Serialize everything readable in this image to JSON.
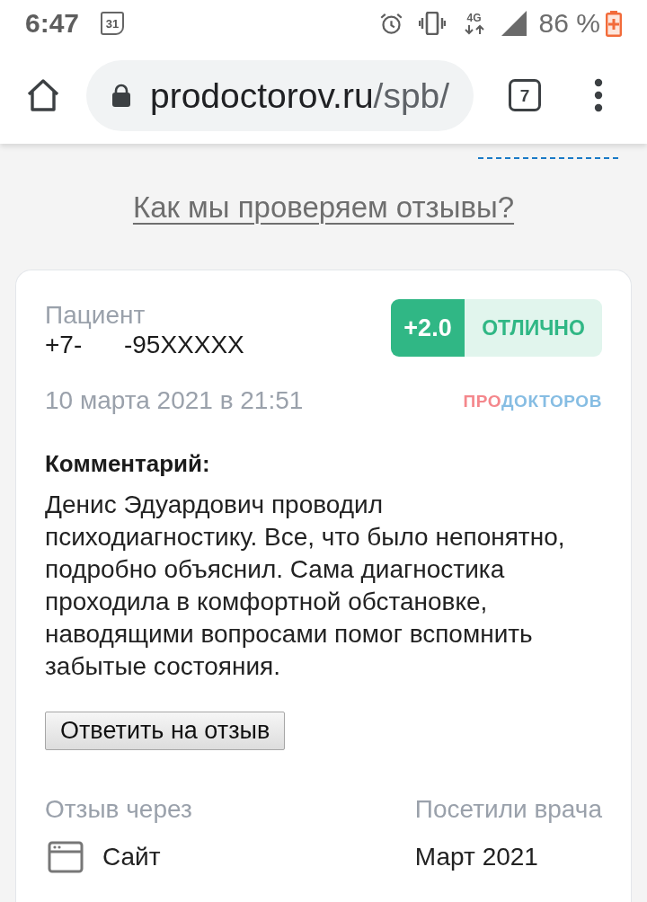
{
  "status_bar": {
    "time": "6:47",
    "calendar_day": "31",
    "network_type": "4G",
    "battery": "86 %"
  },
  "browser": {
    "url_host": "prodoctorov.ru",
    "url_path": "/spb/",
    "tab_count": "7"
  },
  "section": {
    "check_link": "Как мы проверяем отзывы?"
  },
  "review": {
    "author_label": "Пациент",
    "author": "+7-      -95XXXXX",
    "rating": "+2.0",
    "verdict": "ОТЛИЧНО",
    "date": "10 марта 2021 в 21:51",
    "logo": {
      "first": "ПРО",
      "second": "ДОКТОРОВ"
    },
    "comment_label": "Комментарий:",
    "comment": "Денис Эдуардович проводил психодиагностику. Все, что было непонятно, подробно объяснил. Сама диагностика проходила в комфортной обстановке, наводящими вопросами помог вспомнить забытые состояния.",
    "reply_button": "Ответить на отзыв",
    "details": [
      {
        "kind": "source",
        "label": "Отзыв через",
        "value": "Сайт"
      },
      {
        "kind": "visit",
        "label": "Посетили врача",
        "value": "Март 2021"
      }
    ]
  }
}
